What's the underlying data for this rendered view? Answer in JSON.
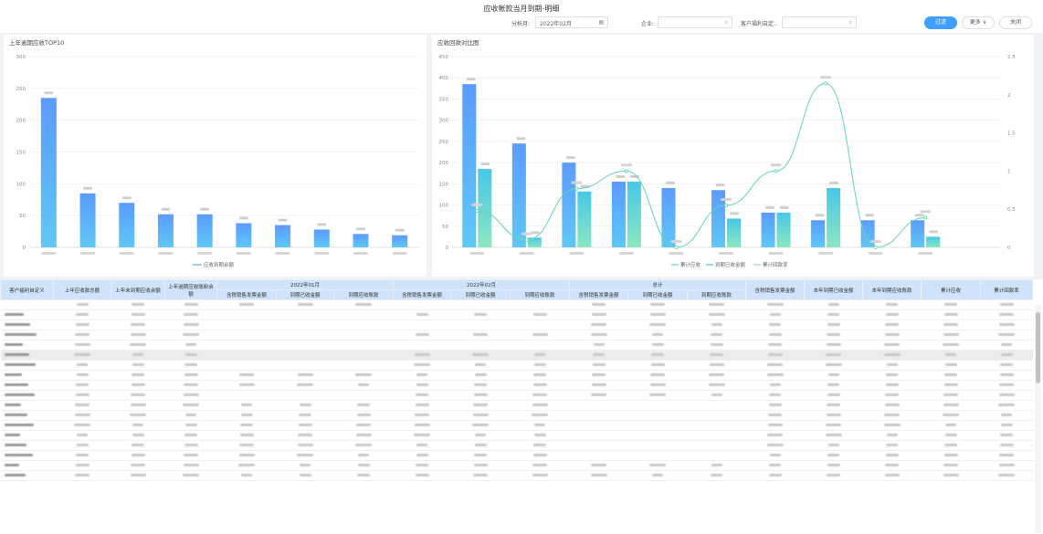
{
  "title": "应收帐款当月到期-明细",
  "filters": {
    "period_label": "分析月:",
    "period_value": "2022年02月",
    "company_label": "企业:",
    "company_value": "",
    "customer_label": "客户福利自定...",
    "customer_value": ""
  },
  "buttons": {
    "filter": "过滤",
    "more": "更多 ∨",
    "close": "关闭"
  },
  "colors": {
    "blue_top": "#5b9bff",
    "blue_bottom": "#5fc8f5",
    "cyan_top": "#48c7e8",
    "cyan_bottom": "#8be7c0",
    "line": "#5fd8b0",
    "header_bg": "#cfe3fb",
    "primary": "#409eff"
  },
  "icons": {
    "calendar": "calendar-icon",
    "search": "search-icon"
  },
  "chart_data": [
    {
      "type": "bar",
      "title": "上年逾期应收TOP10",
      "categories": [
        "",
        "",
        "",
        "",
        "",
        "",
        "",
        "",
        "",
        ""
      ],
      "series": [
        {
          "name": "应收到期余额",
          "values": [
            235,
            85,
            70,
            52,
            52,
            38,
            35,
            28,
            21,
            19
          ]
        }
      ],
      "ylim": [
        0,
        300
      ],
      "yticks": [
        "0",
        "50",
        "100",
        "150",
        "200",
        "250",
        "300"
      ],
      "legend": "bottom"
    },
    {
      "type": "bar",
      "title": "应收回款对比图",
      "categories": [
        "",
        "",
        "",
        "",
        "",
        "",
        "",
        "",
        "",
        "",
        ""
      ],
      "series": [
        {
          "name": "累计应收",
          "values": [
            385,
            245,
            200,
            155,
            140,
            135,
            82,
            64,
            64,
            64,
            0
          ]
        },
        {
          "name": "到期已收金额",
          "values": [
            185,
            23,
            132,
            155,
            0,
            68,
            82,
            140,
            0,
            25,
            0
          ]
        },
        {
          "name": "累计回款率",
          "axis": "right",
          "values": [
            0.48,
            0.1,
            0.77,
            1.0,
            0.0,
            0.55,
            1.0,
            2.15,
            0.0,
            0.39,
            0
          ]
        }
      ],
      "ylim": [
        0,
        450
      ],
      "yticks": [
        "0",
        "50",
        "100",
        "150",
        "200",
        "250",
        "300",
        "350",
        "400",
        "450"
      ],
      "y2lim": [
        0,
        2.5
      ],
      "y2ticks": [
        "0",
        "0.5",
        "1",
        "1.5",
        "2",
        "2.5"
      ],
      "legend": "bottom-right"
    }
  ],
  "table": {
    "group_headers": [
      "2022年01月",
      "2022年02月",
      "总计"
    ],
    "col_customer": "客户福利自定义",
    "col_prev_total": "上年应收款总额",
    "col_prev_undue": "上年末到期应收余额",
    "col_prev_overdue": "上年逾期应收账龄余额",
    "sub_headers": [
      "含税销售发票金额",
      "到期已收金额",
      "到期应收账款"
    ],
    "col_this_year_invoice": "含税销售发票金额",
    "col_this_year_recv": "本年到期已收金额",
    "col_this_year_due": "本年到期应收账款",
    "col_cum_recv": "累计应收",
    "col_cum_rate": "累计回款率"
  }
}
